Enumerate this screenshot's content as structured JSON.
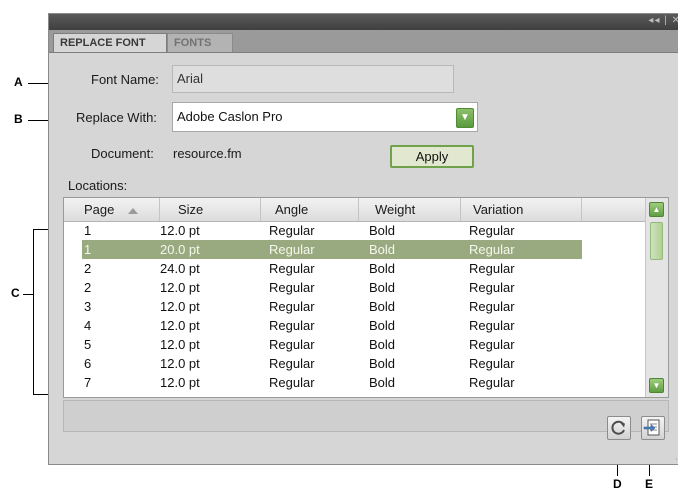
{
  "callouts": {
    "a": "A",
    "b": "B",
    "c": "C",
    "d": "D",
    "e": "E"
  },
  "tabs": {
    "replace_font": "REPLACE FONT",
    "fonts": "FONTS"
  },
  "titlebar": {
    "controls": "◂◂ | ✕"
  },
  "form": {
    "font_name_label": "Font Name:",
    "font_name_value": "Arial",
    "replace_with_label": "Replace With:",
    "replace_with_value": "Adobe Caslon Pro",
    "document_label": "Document:",
    "document_value": "resource.fm",
    "apply_label": "Apply",
    "locations_label": "Locations:"
  },
  "table": {
    "columns": [
      "Page",
      "Size",
      "Angle",
      "Weight",
      "Variation"
    ],
    "rows": [
      {
        "page": "1",
        "size": "12.0 pt",
        "angle": "Regular",
        "weight": "Bold",
        "variation": "Regular",
        "selected": false
      },
      {
        "page": "1",
        "size": "20.0 pt",
        "angle": "Regular",
        "weight": "Bold",
        "variation": "Regular",
        "selected": true
      },
      {
        "page": "2",
        "size": "24.0 pt",
        "angle": "Regular",
        "weight": "Bold",
        "variation": "Regular",
        "selected": false
      },
      {
        "page": "2",
        "size": "12.0 pt",
        "angle": "Regular",
        "weight": "Bold",
        "variation": "Regular",
        "selected": false
      },
      {
        "page": "3",
        "size": "12.0 pt",
        "angle": "Regular",
        "weight": "Bold",
        "variation": "Regular",
        "selected": false
      },
      {
        "page": "4",
        "size": "12.0 pt",
        "angle": "Regular",
        "weight": "Bold",
        "variation": "Regular",
        "selected": false
      },
      {
        "page": "5",
        "size": "12.0 pt",
        "angle": "Regular",
        "weight": "Bold",
        "variation": "Regular",
        "selected": false
      },
      {
        "page": "6",
        "size": "12.0 pt",
        "angle": "Regular",
        "weight": "Bold",
        "variation": "Regular",
        "selected": false
      },
      {
        "page": "7",
        "size": "12.0 pt",
        "angle": "Regular",
        "weight": "Bold",
        "variation": "Regular",
        "selected": false
      }
    ]
  },
  "icons": {
    "refresh": "refresh-icon",
    "goto": "go-to-source-icon",
    "dropdown": "chevron-down-icon",
    "sort": "sort-ascending-icon"
  },
  "colors": {
    "accent_green": "#6fa24a",
    "selection_row": "#9aaa80",
    "panel_bg": "#d6d6d6",
    "titlebar": "#3f3f3f"
  }
}
